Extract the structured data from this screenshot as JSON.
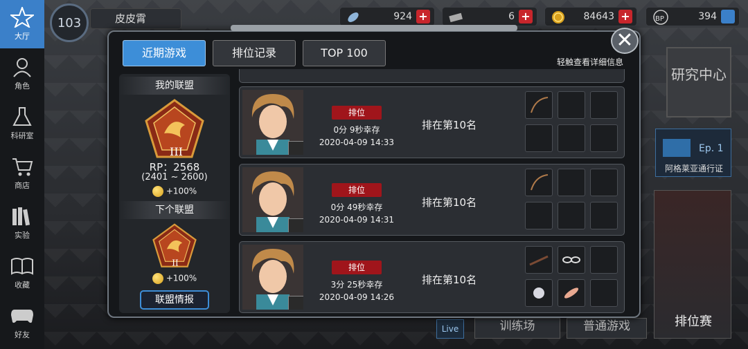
{
  "nav": {
    "items": [
      {
        "label": "大厅",
        "icon": "lobby-icon"
      },
      {
        "label": "角色",
        "icon": "character-icon"
      },
      {
        "label": "科研室",
        "icon": "flask-icon"
      },
      {
        "label": "商店",
        "icon": "cart-icon"
      },
      {
        "label": "实验",
        "icon": "books-icon"
      },
      {
        "label": "收藏",
        "icon": "book-icon"
      },
      {
        "label": "好友",
        "icon": "gamepad-icon"
      }
    ]
  },
  "player": {
    "level": "103",
    "name": "皮皮霄"
  },
  "resources": [
    {
      "icon": "feather-icon",
      "value": "924"
    },
    {
      "icon": "ticket-icon",
      "value": "6"
    },
    {
      "icon": "coin-icon",
      "value": "84643"
    },
    {
      "icon": "bp-icon",
      "value": "394"
    }
  ],
  "tabs": [
    {
      "label": "近期游戏",
      "active": true
    },
    {
      "label": "排位记录",
      "active": false
    },
    {
      "label": "TOP 100",
      "active": false
    }
  ],
  "hint": "轻触查看详细信息",
  "alliance": {
    "my_title": "我的联盟",
    "my_tier": "III",
    "rp": "RP：2568",
    "rp_range": "(2401 ~ 2600)",
    "my_bonus": "+100%",
    "next_title": "下个联盟",
    "next_tier": "II",
    "next_bonus": "+100%",
    "info_button": "联盟情报"
  },
  "games": [
    {
      "mode": "排位",
      "survival": "0分 9秒幸存",
      "date": "2020-04-09 14:33",
      "rank": "排在第10名",
      "items": [
        "bow",
        "",
        "",
        "",
        "",
        ""
      ]
    },
    {
      "mode": "排位",
      "survival": "0分 49秒幸存",
      "date": "2020-04-09 14:31",
      "rank": "排在第10名",
      "items": [
        "bow",
        "",
        "",
        "",
        "",
        ""
      ]
    },
    {
      "mode": "排位",
      "survival": "3分 25秒幸存",
      "date": "2020-04-09 14:26",
      "rank": "排在第10名",
      "items": [
        "rifle",
        "goggles",
        "",
        "fur",
        "feather",
        ""
      ]
    }
  ],
  "background": {
    "research_center": "研究中心",
    "pass_label": "阿格莱亚通行证",
    "pass_ep": "Ep. 1",
    "ranked_button": "排位赛",
    "training_button": "训练场",
    "normal_button": "普通游戏",
    "live": "Live"
  }
}
